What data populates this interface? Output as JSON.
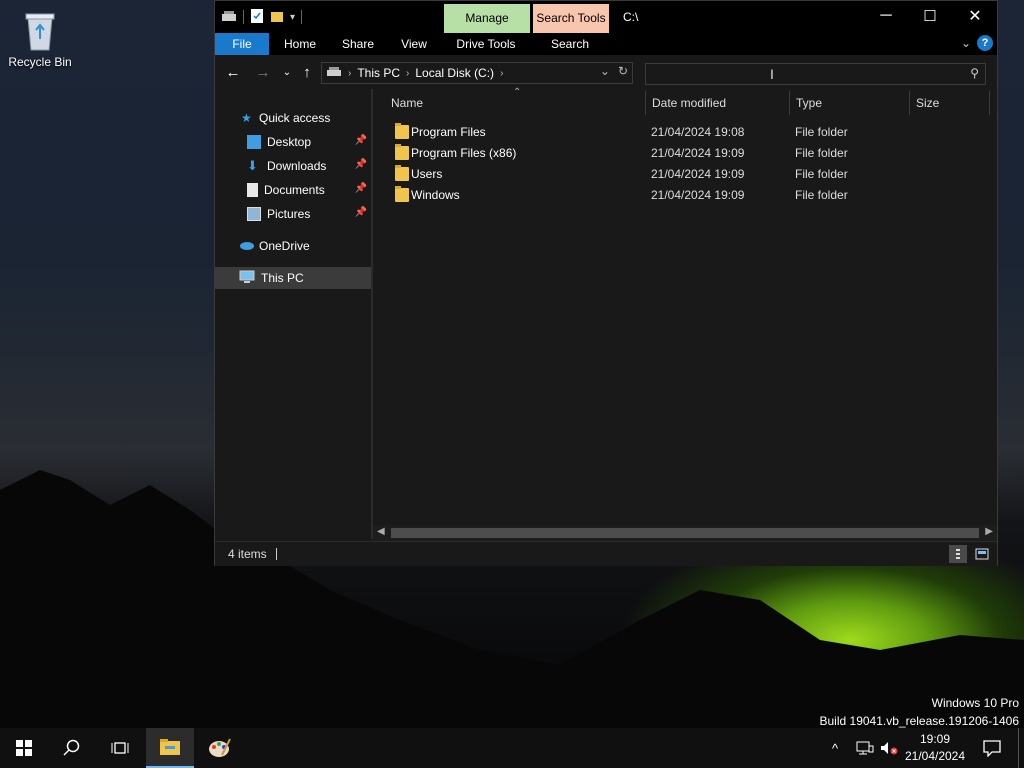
{
  "desktop": {
    "recycle_bin_label": "Recycle Bin",
    "watermark_line1": "Windows 10 Pro",
    "watermark_line2": "Build 19041.vb_release.191206-1406"
  },
  "window": {
    "title": "C:\\",
    "context_tabs": {
      "manage": "Manage",
      "search_tools": "Search Tools"
    },
    "ribbon_tabs": [
      "File",
      "Home",
      "Share",
      "View",
      "Drive Tools",
      "Search"
    ],
    "controls": {
      "minimize": "─",
      "maximize": "☐",
      "close": "✕"
    },
    "help": "?"
  },
  "address": {
    "crumbs": [
      "This PC",
      "Local Disk (C:)"
    ],
    "search_value": ""
  },
  "nav": {
    "quick_access": "Quick access",
    "desktop": "Desktop",
    "downloads": "Downloads",
    "documents": "Documents",
    "pictures": "Pictures",
    "onedrive": "OneDrive",
    "this_pc": "This PC"
  },
  "columns": {
    "name": "Name",
    "date": "Date modified",
    "type": "Type",
    "size": "Size"
  },
  "files": [
    {
      "name": "Program Files",
      "date": "21/04/2024 19:08",
      "type": "File folder"
    },
    {
      "name": "Program Files (x86)",
      "date": "21/04/2024 19:09",
      "type": "File folder"
    },
    {
      "name": "Users",
      "date": "21/04/2024 19:09",
      "type": "File folder"
    },
    {
      "name": "Windows",
      "date": "21/04/2024 19:09",
      "type": "File folder"
    }
  ],
  "status": {
    "items": "4 items"
  },
  "taskbar": {
    "time": "19:09",
    "date": "21/04/2024"
  },
  "colors": {
    "accent": "#1979ca",
    "manage_tab": "#b6e0a6",
    "search_tab": "#f7c6ac",
    "folder": "#f0c54e"
  }
}
